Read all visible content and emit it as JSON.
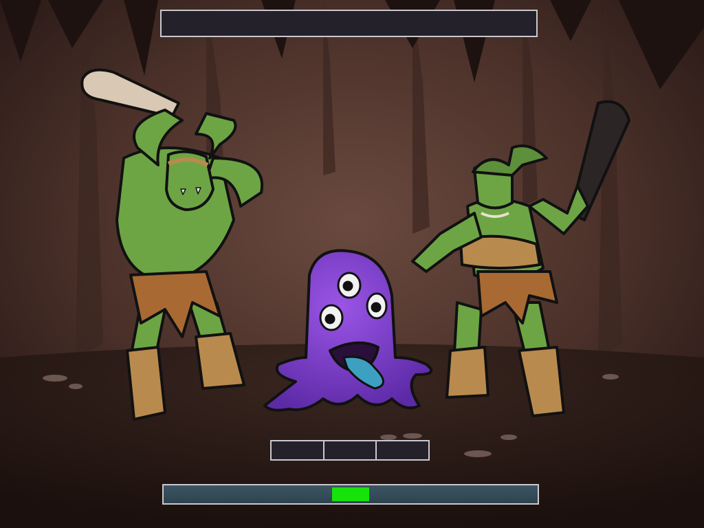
{
  "hud": {
    "top_bar_text": "",
    "action_slots": [
      "",
      "",
      ""
    ]
  },
  "timing_bar": {
    "zone_start": 0.45,
    "zone_end": 0.55,
    "zone_color": "#16e30c",
    "track_color": "#3d5563"
  },
  "scene": {
    "location": "cave",
    "characters": [
      {
        "id": "orc-male",
        "role": "enemy",
        "weapon": "bone-club"
      },
      {
        "id": "purple-slime-monster",
        "role": "player"
      },
      {
        "id": "orc-female",
        "role": "enemy",
        "weapon": "dark-club"
      }
    ]
  },
  "colors": {
    "frame_border": "#c9c9cf",
    "panel_fill": "#25212b",
    "orc_skin": "#6da545",
    "slime": "#7a3cc9"
  }
}
